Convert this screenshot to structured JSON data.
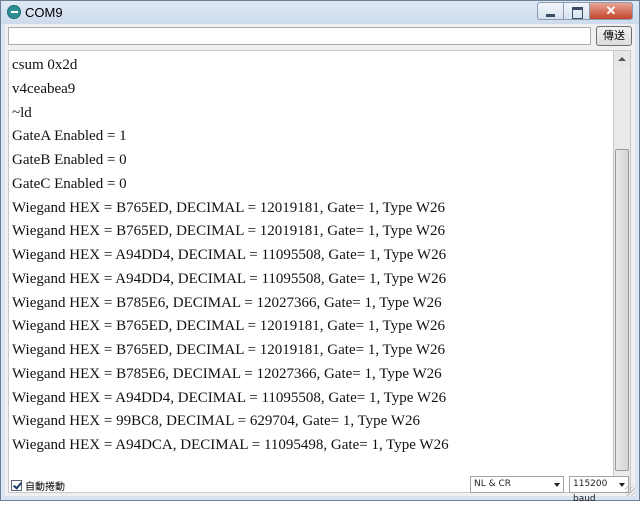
{
  "window": {
    "title": "COM9"
  },
  "send": {
    "input_value": "",
    "button_label": "傳送"
  },
  "output": {
    "lines": [
      "csum 0x2d",
      "v4ceabea9",
      "~ld",
      "GateA Enabled = 1",
      "GateB Enabled = 0",
      "GateC Enabled = 0",
      "Wiegand HEX = B765ED, DECIMAL = 12019181, Gate= 1, Type W26",
      "Wiegand HEX = B765ED, DECIMAL = 12019181, Gate= 1, Type W26",
      "Wiegand HEX = A94DD4, DECIMAL = 11095508, Gate= 1, Type W26",
      "Wiegand HEX = A94DD4, DECIMAL = 11095508, Gate= 1, Type W26",
      "Wiegand HEX = B785E6, DECIMAL = 12027366, Gate= 1, Type W26",
      "Wiegand HEX = B765ED, DECIMAL = 12019181, Gate= 1, Type W26",
      "Wiegand HEX = B765ED, DECIMAL = 12019181, Gate= 1, Type W26",
      "Wiegand HEX = B785E6, DECIMAL = 12027366, Gate= 1, Type W26",
      "Wiegand HEX = A94DD4, DECIMAL = 11095508, Gate= 1, Type W26",
      "Wiegand HEX = 99BC8, DECIMAL = 629704, Gate= 1, Type W26",
      "Wiegand HEX = A94DCA, DECIMAL = 11095498, Gate= 1, Type W26"
    ]
  },
  "footer": {
    "autoscroll_label": "自動捲動",
    "autoscroll_checked": true,
    "line_ending": "NL & CR",
    "baud_rate": "115200 baud"
  }
}
